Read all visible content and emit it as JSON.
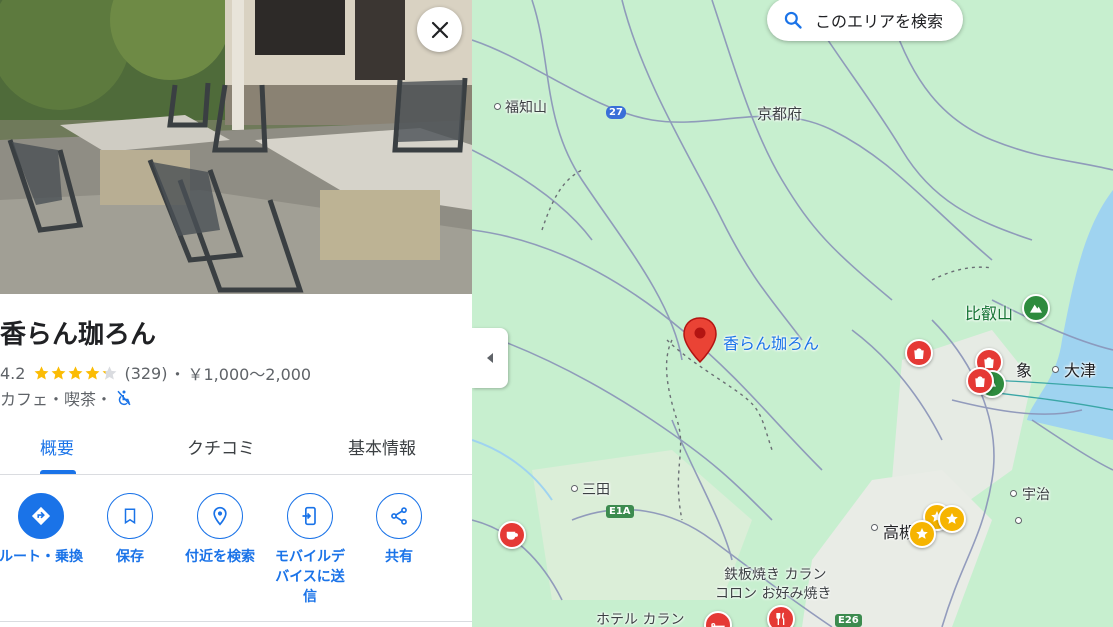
{
  "place": {
    "name": "香らん珈ろん",
    "rating": "4.2",
    "rating_value": 4.2,
    "review_count": "(329)",
    "separator": "・",
    "price_range": "￥1,000～2,000",
    "category": "カフェ・喫茶・",
    "accessibility_icon": "not-accessible-icon"
  },
  "tabs": [
    {
      "label": "概要",
      "active": true
    },
    {
      "label": "クチコミ",
      "active": false
    },
    {
      "label": "基本情報",
      "active": false
    }
  ],
  "actions": [
    {
      "label": "ルート・乗換",
      "icon": "directions-icon"
    },
    {
      "label": "保存",
      "icon": "bookmark-icon"
    },
    {
      "label": "付近を検索",
      "icon": "nearby-search-icon"
    },
    {
      "label": "モバイルデバイスに送信",
      "icon": "send-to-phone-icon"
    },
    {
      "label": "共有",
      "icon": "share-icon"
    }
  ],
  "map": {
    "search_area_label": "このエリアを検索",
    "pin_label": "香らん珈ろん",
    "labels": {
      "fukuchiyama": "福知山",
      "kyoto_fu": "京都府",
      "hiei": "比叡山",
      "zo": "象",
      "otsu": "大津",
      "uji": "宇治",
      "sanda": "三田",
      "taka": "高槻",
      "teppan": "鉄板焼き カラン",
      "koron": "コロン お好み焼き",
      "hotel": "ホテル カラン"
    },
    "shields": {
      "route27": "27",
      "e1a": "E1A",
      "e26": "E26"
    }
  },
  "colors": {
    "accent": "#1a73e8",
    "map_green": "#c7efcf",
    "pin_red": "#ea4335",
    "star_yellow": "#fbbc04"
  }
}
